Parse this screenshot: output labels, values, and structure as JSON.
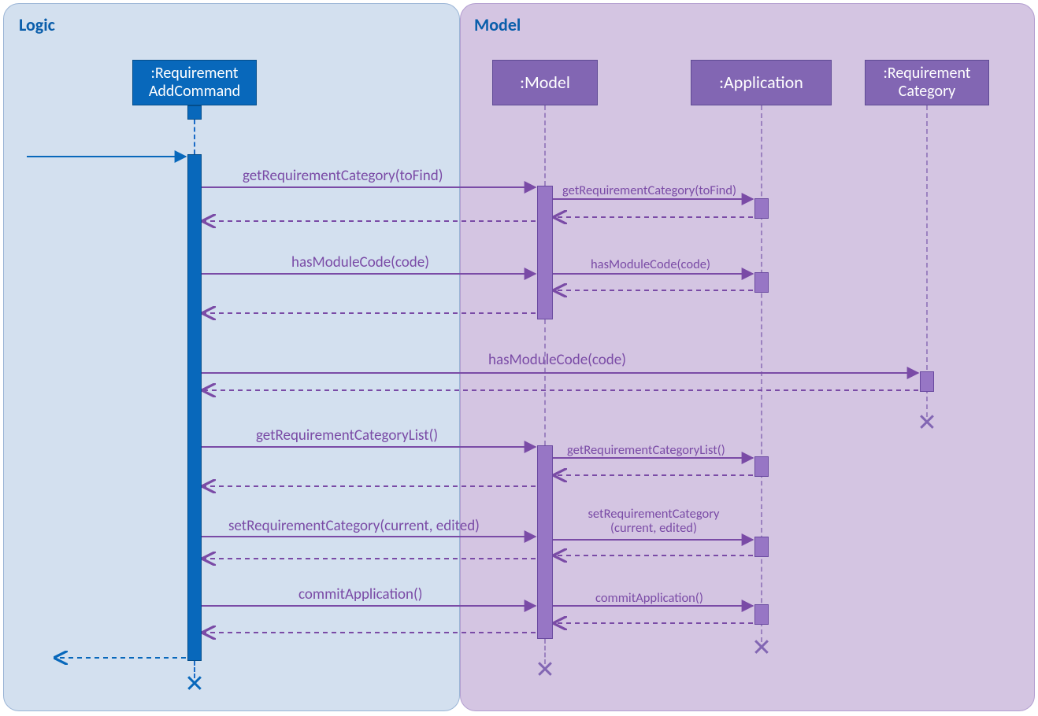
{
  "regions": {
    "logic": "Logic",
    "model": "Model"
  },
  "lifelines": {
    "cmd": {
      "line1": ":Requirement",
      "line2": "AddCommand"
    },
    "model": ":Model",
    "app": ":Application",
    "reqcat": {
      "line1": ":Requirement",
      "line2": "Category"
    }
  },
  "messages": {
    "m1": "getRequirementCategory(toFind)",
    "m1b": "getRequirementCategory(toFind)",
    "m2": "hasModuleCode(code)",
    "m2b": "hasModuleCode(code)",
    "m3": "hasModuleCode(code)",
    "m4": "getRequirementCategoryList()",
    "m4b": "getRequirementCategoryList()",
    "m5": "setRequirementCategory(current, edited)",
    "m5b_l1": "setRequirementCategory",
    "m5b_l2": "(current, edited)",
    "m6": "commitApplication()",
    "m6b": "commitApplication()"
  }
}
